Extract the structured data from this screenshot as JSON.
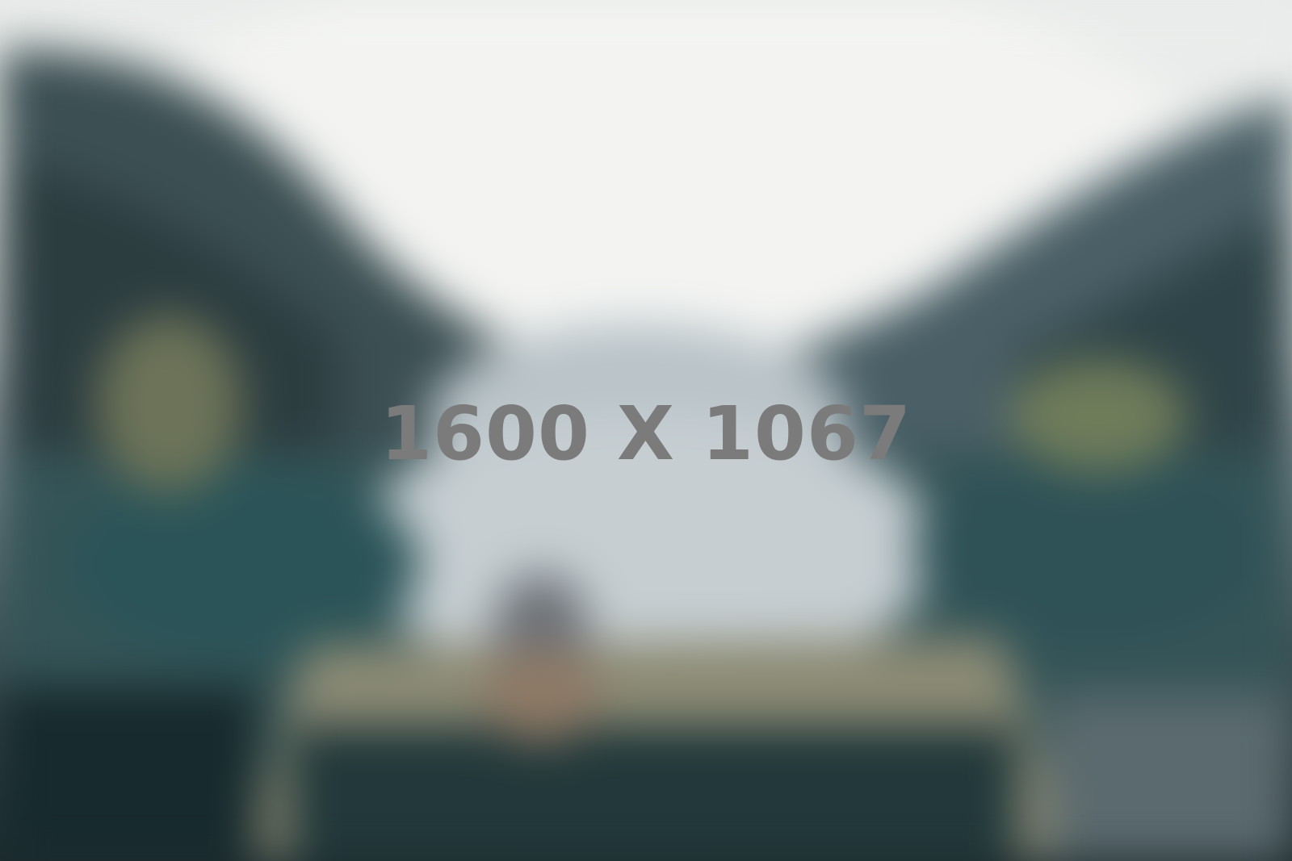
{
  "image": {
    "placeholder_text": "1600 X 1067",
    "text_color": "#7b7b7b"
  },
  "colors": {
    "sky": "#f0f1ef",
    "mountain_dark": "#2e4245",
    "water_teal": "#2f5457",
    "dock": "#8a8a72",
    "deep_shadow": "#15292b"
  }
}
